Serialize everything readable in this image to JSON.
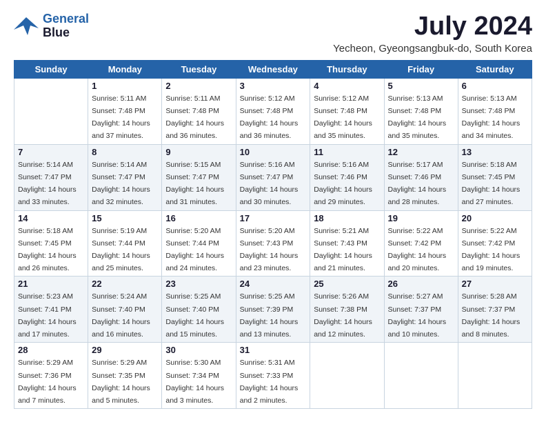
{
  "header": {
    "logo_line1": "General",
    "logo_line2": "Blue",
    "month_year": "July 2024",
    "location": "Yecheon, Gyeongsangbuk-do, South Korea"
  },
  "weekdays": [
    "Sunday",
    "Monday",
    "Tuesday",
    "Wednesday",
    "Thursday",
    "Friday",
    "Saturday"
  ],
  "weeks": [
    [
      {
        "day": "",
        "sunrise": "",
        "sunset": "",
        "daylight": ""
      },
      {
        "day": "1",
        "sunrise": "Sunrise: 5:11 AM",
        "sunset": "Sunset: 7:48 PM",
        "daylight": "Daylight: 14 hours and 37 minutes."
      },
      {
        "day": "2",
        "sunrise": "Sunrise: 5:11 AM",
        "sunset": "Sunset: 7:48 PM",
        "daylight": "Daylight: 14 hours and 36 minutes."
      },
      {
        "day": "3",
        "sunrise": "Sunrise: 5:12 AM",
        "sunset": "Sunset: 7:48 PM",
        "daylight": "Daylight: 14 hours and 36 minutes."
      },
      {
        "day": "4",
        "sunrise": "Sunrise: 5:12 AM",
        "sunset": "Sunset: 7:48 PM",
        "daylight": "Daylight: 14 hours and 35 minutes."
      },
      {
        "day": "5",
        "sunrise": "Sunrise: 5:13 AM",
        "sunset": "Sunset: 7:48 PM",
        "daylight": "Daylight: 14 hours and 35 minutes."
      },
      {
        "day": "6",
        "sunrise": "Sunrise: 5:13 AM",
        "sunset": "Sunset: 7:48 PM",
        "daylight": "Daylight: 14 hours and 34 minutes."
      }
    ],
    [
      {
        "day": "7",
        "sunrise": "Sunrise: 5:14 AM",
        "sunset": "Sunset: 7:47 PM",
        "daylight": "Daylight: 14 hours and 33 minutes."
      },
      {
        "day": "8",
        "sunrise": "Sunrise: 5:14 AM",
        "sunset": "Sunset: 7:47 PM",
        "daylight": "Daylight: 14 hours and 32 minutes."
      },
      {
        "day": "9",
        "sunrise": "Sunrise: 5:15 AM",
        "sunset": "Sunset: 7:47 PM",
        "daylight": "Daylight: 14 hours and 31 minutes."
      },
      {
        "day": "10",
        "sunrise": "Sunrise: 5:16 AM",
        "sunset": "Sunset: 7:47 PM",
        "daylight": "Daylight: 14 hours and 30 minutes."
      },
      {
        "day": "11",
        "sunrise": "Sunrise: 5:16 AM",
        "sunset": "Sunset: 7:46 PM",
        "daylight": "Daylight: 14 hours and 29 minutes."
      },
      {
        "day": "12",
        "sunrise": "Sunrise: 5:17 AM",
        "sunset": "Sunset: 7:46 PM",
        "daylight": "Daylight: 14 hours and 28 minutes."
      },
      {
        "day": "13",
        "sunrise": "Sunrise: 5:18 AM",
        "sunset": "Sunset: 7:45 PM",
        "daylight": "Daylight: 14 hours and 27 minutes."
      }
    ],
    [
      {
        "day": "14",
        "sunrise": "Sunrise: 5:18 AM",
        "sunset": "Sunset: 7:45 PM",
        "daylight": "Daylight: 14 hours and 26 minutes."
      },
      {
        "day": "15",
        "sunrise": "Sunrise: 5:19 AM",
        "sunset": "Sunset: 7:44 PM",
        "daylight": "Daylight: 14 hours and 25 minutes."
      },
      {
        "day": "16",
        "sunrise": "Sunrise: 5:20 AM",
        "sunset": "Sunset: 7:44 PM",
        "daylight": "Daylight: 14 hours and 24 minutes."
      },
      {
        "day": "17",
        "sunrise": "Sunrise: 5:20 AM",
        "sunset": "Sunset: 7:43 PM",
        "daylight": "Daylight: 14 hours and 23 minutes."
      },
      {
        "day": "18",
        "sunrise": "Sunrise: 5:21 AM",
        "sunset": "Sunset: 7:43 PM",
        "daylight": "Daylight: 14 hours and 21 minutes."
      },
      {
        "day": "19",
        "sunrise": "Sunrise: 5:22 AM",
        "sunset": "Sunset: 7:42 PM",
        "daylight": "Daylight: 14 hours and 20 minutes."
      },
      {
        "day": "20",
        "sunrise": "Sunrise: 5:22 AM",
        "sunset": "Sunset: 7:42 PM",
        "daylight": "Daylight: 14 hours and 19 minutes."
      }
    ],
    [
      {
        "day": "21",
        "sunrise": "Sunrise: 5:23 AM",
        "sunset": "Sunset: 7:41 PM",
        "daylight": "Daylight: 14 hours and 17 minutes."
      },
      {
        "day": "22",
        "sunrise": "Sunrise: 5:24 AM",
        "sunset": "Sunset: 7:40 PM",
        "daylight": "Daylight: 14 hours and 16 minutes."
      },
      {
        "day": "23",
        "sunrise": "Sunrise: 5:25 AM",
        "sunset": "Sunset: 7:40 PM",
        "daylight": "Daylight: 14 hours and 15 minutes."
      },
      {
        "day": "24",
        "sunrise": "Sunrise: 5:25 AM",
        "sunset": "Sunset: 7:39 PM",
        "daylight": "Daylight: 14 hours and 13 minutes."
      },
      {
        "day": "25",
        "sunrise": "Sunrise: 5:26 AM",
        "sunset": "Sunset: 7:38 PM",
        "daylight": "Daylight: 14 hours and 12 minutes."
      },
      {
        "day": "26",
        "sunrise": "Sunrise: 5:27 AM",
        "sunset": "Sunset: 7:37 PM",
        "daylight": "Daylight: 14 hours and 10 minutes."
      },
      {
        "day": "27",
        "sunrise": "Sunrise: 5:28 AM",
        "sunset": "Sunset: 7:37 PM",
        "daylight": "Daylight: 14 hours and 8 minutes."
      }
    ],
    [
      {
        "day": "28",
        "sunrise": "Sunrise: 5:29 AM",
        "sunset": "Sunset: 7:36 PM",
        "daylight": "Daylight: 14 hours and 7 minutes."
      },
      {
        "day": "29",
        "sunrise": "Sunrise: 5:29 AM",
        "sunset": "Sunset: 7:35 PM",
        "daylight": "Daylight: 14 hours and 5 minutes."
      },
      {
        "day": "30",
        "sunrise": "Sunrise: 5:30 AM",
        "sunset": "Sunset: 7:34 PM",
        "daylight": "Daylight: 14 hours and 3 minutes."
      },
      {
        "day": "31",
        "sunrise": "Sunrise: 5:31 AM",
        "sunset": "Sunset: 7:33 PM",
        "daylight": "Daylight: 14 hours and 2 minutes."
      },
      {
        "day": "",
        "sunrise": "",
        "sunset": "",
        "daylight": ""
      },
      {
        "day": "",
        "sunrise": "",
        "sunset": "",
        "daylight": ""
      },
      {
        "day": "",
        "sunrise": "",
        "sunset": "",
        "daylight": ""
      }
    ]
  ]
}
